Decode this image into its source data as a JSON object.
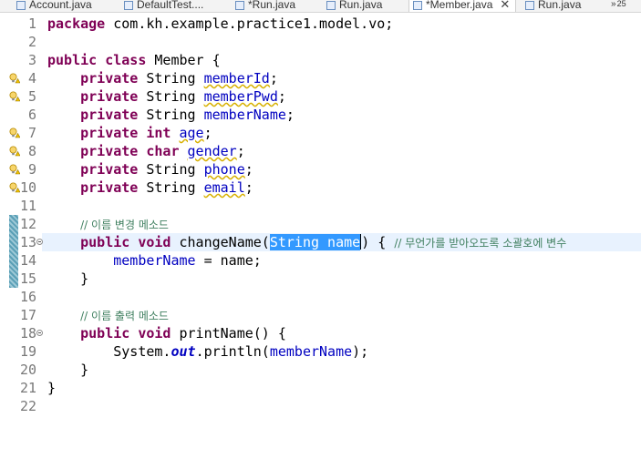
{
  "tabs": [
    {
      "label": "Account.java",
      "active": false
    },
    {
      "label": "DefaultTest....",
      "active": false
    },
    {
      "label": "*Run.java",
      "active": false
    },
    {
      "label": "Run.java",
      "active": false
    },
    {
      "label": "*Member.java",
      "active": true,
      "close": "✕"
    },
    {
      "label": "Run.java",
      "active": false
    }
  ],
  "tab_overflow": {
    "arrows": "»",
    "count": "25"
  },
  "editor": {
    "lines": [
      {
        "n": "1"
      },
      {
        "n": "2"
      },
      {
        "n": "3"
      },
      {
        "n": "4"
      },
      {
        "n": "5"
      },
      {
        "n": "6"
      },
      {
        "n": "7"
      },
      {
        "n": "8"
      },
      {
        "n": "9"
      },
      {
        "n": "10"
      },
      {
        "n": "11"
      },
      {
        "n": "12"
      },
      {
        "n": "13"
      },
      {
        "n": "14"
      },
      {
        "n": "15"
      },
      {
        "n": "16"
      },
      {
        "n": "17"
      },
      {
        "n": "18"
      },
      {
        "n": "19"
      },
      {
        "n": "20"
      },
      {
        "n": "21"
      },
      {
        "n": "22"
      }
    ],
    "tokens": {
      "l1_kw": "package",
      "l1_rest": " com.kh.example.practice1.model.vo;",
      "l3_kw": "public class",
      "l3_rest": " Member {",
      "private": "private",
      "string_type": "String",
      "int_type": "int",
      "char_type": "char",
      "f_memberId": "memberId",
      "f_memberPwd": "memberPwd",
      "f_memberName": "memberName",
      "f_age": "age",
      "f_gender": "gender",
      "f_phone": "phone",
      "f_email": "email",
      "l12_comment": "// 이름 변경 메소드",
      "public_void": "public void",
      "m_change": " changeName(",
      "sel_param": "String name",
      "l13_after": ") { ",
      "l13_comment": "// 무언가를 받아오도록 소괄호에 변수",
      "l14_rest": " = name;",
      "close_brace": "}",
      "l17_comment": "// 이름 출력 메소드",
      "m_print": " printName() {",
      "l19_a": "System.",
      "l19_out": "out",
      "l19_b": ".println(",
      "l19_c": ");"
    }
  },
  "colors": {
    "keyword": "#7f0055",
    "field": "#0000c0",
    "comment": "#3f7f5f",
    "selection": "#3399ff",
    "line_number": "#787878"
  }
}
